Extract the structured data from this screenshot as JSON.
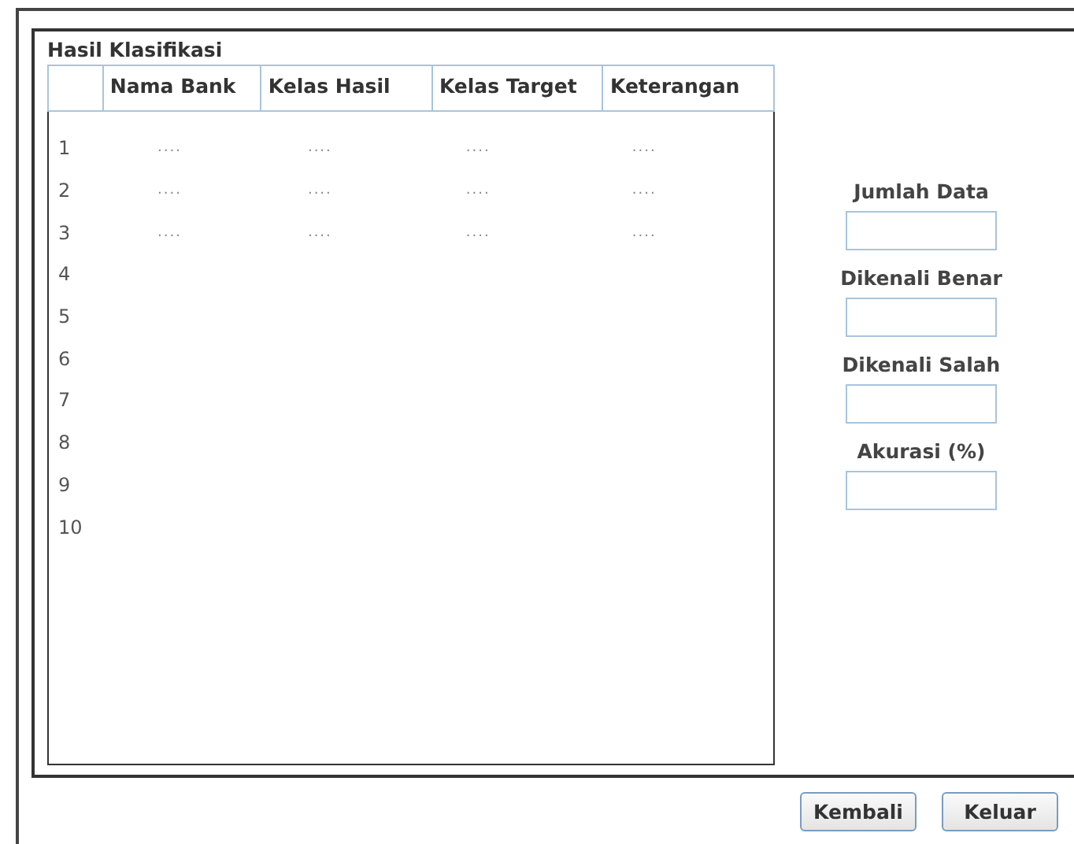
{
  "panel": {
    "title": "Hasil Klasifikasi"
  },
  "table": {
    "columns": [
      "Nama Bank",
      "Kelas Hasil",
      "Kelas Target",
      "Keterangan"
    ],
    "rows": [
      {
        "number": "1",
        "cells": [
          "....",
          "....",
          "....",
          "...."
        ]
      },
      {
        "number": "2",
        "cells": [
          "....",
          "....",
          "....",
          "...."
        ]
      },
      {
        "number": "3",
        "cells": [
          "....",
          "....",
          "....",
          "...."
        ]
      },
      {
        "number": "4",
        "cells": []
      },
      {
        "number": "5",
        "cells": []
      },
      {
        "number": "6",
        "cells": []
      },
      {
        "number": "7",
        "cells": []
      },
      {
        "number": "8",
        "cells": []
      },
      {
        "number": "9",
        "cells": []
      },
      {
        "number": "10",
        "cells": []
      }
    ]
  },
  "fields": [
    {
      "label": "Jumlah Data"
    },
    {
      "label": "Dikenali Benar"
    },
    {
      "label": "Dikenali Salah"
    },
    {
      "label": "Akurasi (%)"
    }
  ],
  "buttons": [
    "Kembali",
    "Keluar"
  ]
}
